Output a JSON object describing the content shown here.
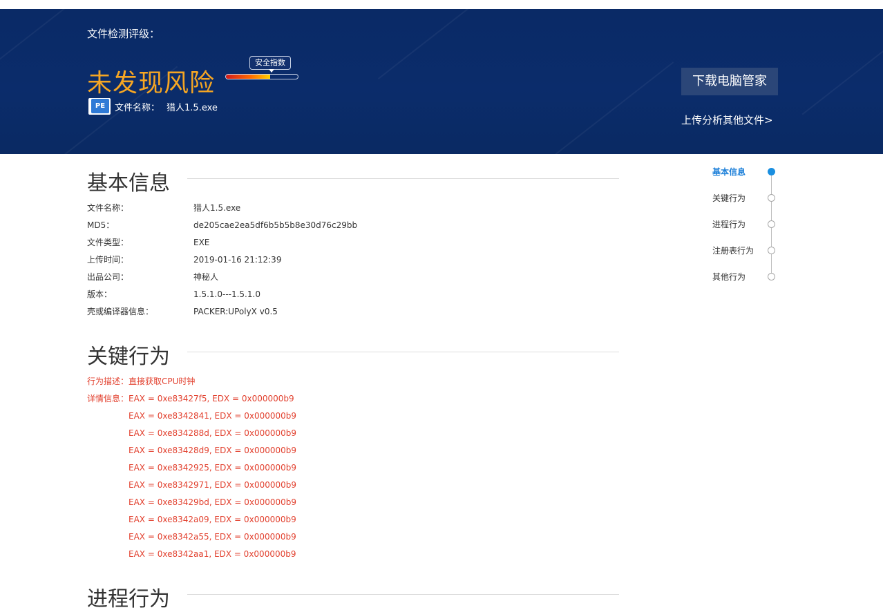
{
  "banner": {
    "rating_label": "文件检测评级：",
    "risk_title": "未发现风险",
    "score_tag": "安全指数",
    "score_level": 0.62,
    "file_icon": "PE",
    "file_label": "文件名称：",
    "file_name": "猎人1.5.exe",
    "download_button": "下载电脑管家",
    "upload_link": "上传分析其他文件>",
    "colors": {
      "background": "#0b2c6b",
      "risk_title": "#f6a623",
      "button": "#2b4678"
    }
  },
  "basic_info": {
    "title": "基本信息",
    "rows": [
      {
        "key": "文件名称：",
        "value": "猎人1.5.exe"
      },
      {
        "key": "MD5：",
        "value": "de205cae2ea5df6b5b5b8e30d76c29bb"
      },
      {
        "key": "文件类型：",
        "value": "EXE"
      },
      {
        "key": "上传时间：",
        "value": "2019-01-16 21:12:39"
      },
      {
        "key": "出品公司：",
        "value": "神秘人"
      },
      {
        "key": "版本：",
        "value": "1.5.1.0---1.5.1.0"
      },
      {
        "key": "壳或编译器信息：",
        "value": "PACKER:UPolyX v0.5"
      }
    ]
  },
  "key_behavior": {
    "title": "关键行为",
    "desc_label": "行为描述：",
    "desc_value": "直接获取CPU时钟",
    "detail_label": "详情信息：",
    "details": [
      "EAX = 0xe83427f5, EDX = 0x000000b9",
      "EAX = 0xe8342841, EDX = 0x000000b9",
      "EAX = 0xe834288d, EDX = 0x000000b9",
      "EAX = 0xe83428d9, EDX = 0x000000b9",
      "EAX = 0xe8342925, EDX = 0x000000b9",
      "EAX = 0xe8342971, EDX = 0x000000b9",
      "EAX = 0xe83429bd, EDX = 0x000000b9",
      "EAX = 0xe8342a09, EDX = 0x000000b9",
      "EAX = 0xe8342a55, EDX = 0x000000b9",
      "EAX = 0xe8342aa1, EDX = 0x000000b9"
    ],
    "color": "#e2412f"
  },
  "process_behavior": {
    "title": "进程行为"
  },
  "side_nav": {
    "items": [
      {
        "label": "基本信息",
        "active": true
      },
      {
        "label": "关键行为",
        "active": false
      },
      {
        "label": "进程行为",
        "active": false
      },
      {
        "label": "注册表行为",
        "active": false
      },
      {
        "label": "其他行为",
        "active": false
      }
    ],
    "active_color": "#1a8fe0"
  }
}
